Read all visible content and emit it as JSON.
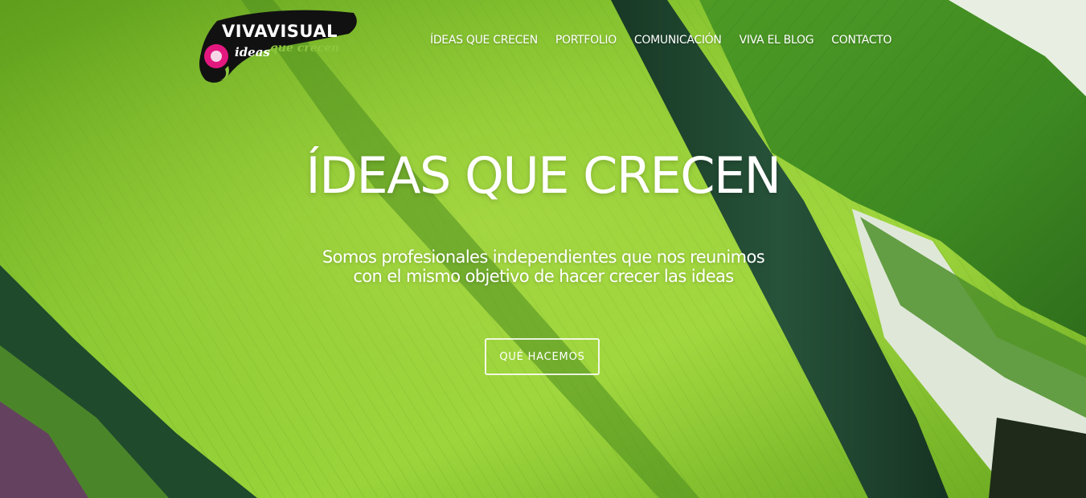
{
  "brand": {
    "name": "VIVAVISUAL",
    "tagline_part1": "ideas",
    "tagline_part2": "que crecen",
    "colors": {
      "logo_black": "#111111",
      "logo_magenta": "#e2187f",
      "logo_green": "#8dc63f"
    }
  },
  "nav": {
    "items": [
      {
        "label": "ÍDEAS QUE CRECEN"
      },
      {
        "label": "PORTFOLIO"
      },
      {
        "label": "COMUNICACIÓN"
      },
      {
        "label": "VIVA EL BLOG"
      },
      {
        "label": "CONTACTO"
      }
    ]
  },
  "hero": {
    "headline": "ÍDEAS QUE CRECEN",
    "subtitle_line1": "Somos profesionales independientes que nos reunimos",
    "subtitle_line2": "con el mismo objetivo de hacer crecer las ideas",
    "cta_label": "QUÉ HACEMOS",
    "background": "banana-leaf-photo",
    "colors": {
      "leaf_green": "#7cc02a",
      "dark_stem": "#1f3d2a",
      "text": "#ffffff"
    }
  }
}
